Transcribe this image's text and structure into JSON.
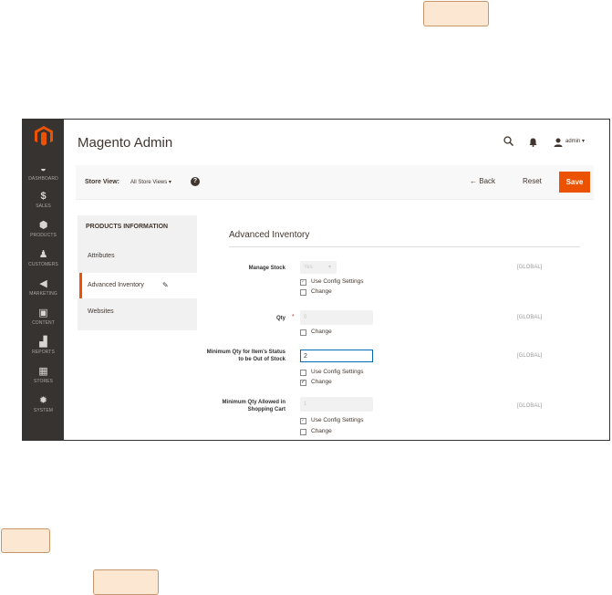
{
  "app": {
    "title": "Magento Admin",
    "user": "admin"
  },
  "nav": {
    "items": [
      {
        "label": "DASHBOARD",
        "icon": "dashboard-icon"
      },
      {
        "label": "SALES",
        "icon": "dollar-icon"
      },
      {
        "label": "PRODUCTS",
        "icon": "cube-icon"
      },
      {
        "label": "CUSTOMERS",
        "icon": "person-icon"
      },
      {
        "label": "MARKETING",
        "icon": "megaphone-icon"
      },
      {
        "label": "CONTENT",
        "icon": "layout-icon"
      },
      {
        "label": "REPORTS",
        "icon": "bar-chart-icon"
      },
      {
        "label": "STORES",
        "icon": "storefront-icon"
      },
      {
        "label": "SYSTEM",
        "icon": "gear-icon"
      }
    ]
  },
  "toolbar": {
    "store_view_label": "Store View:",
    "store_view_value": "All Store Views",
    "back_label": "Back",
    "reset_label": "Reset",
    "save_label": "Save",
    "accent": "#eb5202"
  },
  "panel": {
    "heading": "PRODUCTS INFORMATION",
    "items": [
      "Attributes",
      "Advanced Inventory",
      "Websites"
    ]
  },
  "section": {
    "title": "Advanced Inventory"
  },
  "fields": {
    "manage_stock": {
      "label": "Manage Stock",
      "value": "Yes",
      "scope": "[GLOBAL]",
      "use_config": "Use Config Settings",
      "change": "Change"
    },
    "qty": {
      "label": "Qty",
      "value": "0",
      "scope": "[GLOBAL]",
      "change": "Change"
    },
    "min_qty": {
      "label": "Minimum Qty for Item's Status to be Out of Stock",
      "value": "2",
      "scope": "[GLOBAL]",
      "use_config": "Use Config Settings",
      "change": "Change"
    },
    "min_cart": {
      "label": "Minimum Qty Allowed in Shopping Cart",
      "value": "1",
      "scope": "[GLOBAL]",
      "use_config": "Use Config Settings",
      "change": "Change"
    }
  }
}
